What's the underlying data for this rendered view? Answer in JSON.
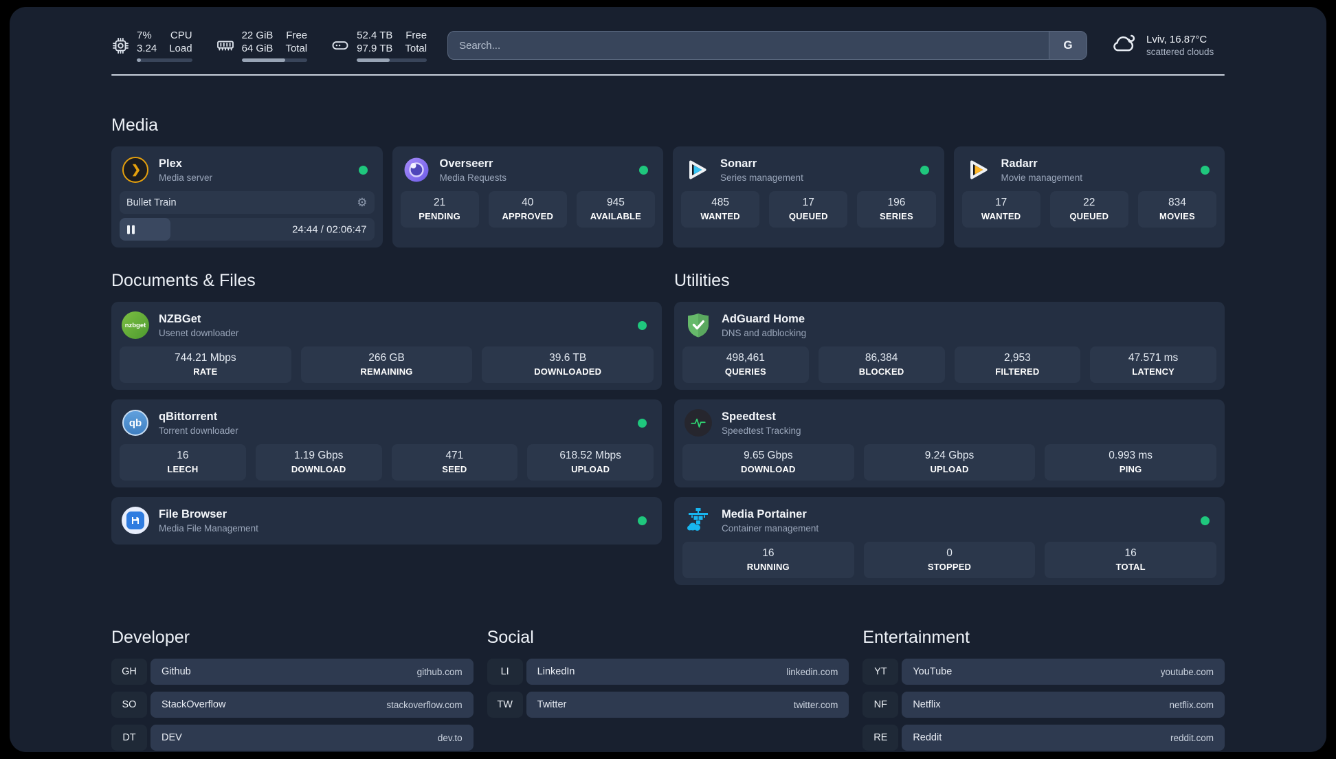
{
  "colors": {
    "status_online": "#1fc77d",
    "accent_plex": "#e5a00d",
    "sonarr_blue": "#36c3f2",
    "radarr_orange": "#ffb626",
    "adguard_green": "#66b96a",
    "portainer_blue": "#18b6f0",
    "speedtest_green": "#2fd573"
  },
  "header": {
    "stats": [
      {
        "icon": "cpu",
        "v1": "7%",
        "v2": "3.24",
        "l1": "CPU",
        "l2": "Load",
        "progress": 8
      },
      {
        "icon": "memory",
        "v1": "22 GiB",
        "v2": "64 GiB",
        "l1": "Free",
        "l2": "Total",
        "progress": 66
      },
      {
        "icon": "disk",
        "v1": "52.4 TB",
        "v2": "97.9 TB",
        "l1": "Free",
        "l2": "Total",
        "progress": 47
      }
    ],
    "search": {
      "placeholder": "Search...",
      "engine_label": "G"
    },
    "weather": {
      "location": "Lviv, 16.87°C",
      "condition": "scattered clouds"
    }
  },
  "sections": {
    "media": {
      "title": "Media",
      "plex": {
        "title": "Plex",
        "subtitle": "Media server",
        "status": "online",
        "now_playing": {
          "title": "Bullet Train",
          "time": "24:44 / 02:06:47",
          "progress": 20
        }
      },
      "overseerr": {
        "title": "Overseerr",
        "subtitle": "Media Requests",
        "status": "online",
        "stats": [
          {
            "value": "21",
            "label": "PENDING"
          },
          {
            "value": "40",
            "label": "APPROVED"
          },
          {
            "value": "945",
            "label": "AVAILABLE"
          }
        ]
      },
      "sonarr": {
        "title": "Sonarr",
        "subtitle": "Series management",
        "status": "online",
        "stats": [
          {
            "value": "485",
            "label": "WANTED"
          },
          {
            "value": "17",
            "label": "QUEUED"
          },
          {
            "value": "196",
            "label": "SERIES"
          }
        ]
      },
      "radarr": {
        "title": "Radarr",
        "subtitle": "Movie management",
        "status": "online",
        "stats": [
          {
            "value": "17",
            "label": "WANTED"
          },
          {
            "value": "22",
            "label": "QUEUED"
          },
          {
            "value": "834",
            "label": "MOVIES"
          }
        ]
      }
    },
    "documents": {
      "title": "Documents & Files",
      "nzbget": {
        "title": "NZBGet",
        "subtitle": "Usenet downloader",
        "status": "online",
        "stats": [
          {
            "value": "744.21 Mbps",
            "label": "RATE"
          },
          {
            "value": "266 GB",
            "label": "REMAINING"
          },
          {
            "value": "39.6 TB",
            "label": "DOWNLOADED"
          }
        ]
      },
      "qbittorrent": {
        "title": "qBittorrent",
        "subtitle": "Torrent downloader",
        "status": "online",
        "stats": [
          {
            "value": "16",
            "label": "LEECH"
          },
          {
            "value": "1.19 Gbps",
            "label": "DOWNLOAD"
          },
          {
            "value": "471",
            "label": "SEED"
          },
          {
            "value": "618.52 Mbps",
            "label": "UPLOAD"
          }
        ]
      },
      "filebrowser": {
        "title": "File Browser",
        "subtitle": "Media File Management",
        "status": "online"
      }
    },
    "utilities": {
      "title": "Utilities",
      "adguard": {
        "title": "AdGuard Home",
        "subtitle": "DNS and adblocking",
        "stats": [
          {
            "value": "498,461",
            "label": "QUERIES"
          },
          {
            "value": "86,384",
            "label": "BLOCKED"
          },
          {
            "value": "2,953",
            "label": "FILTERED"
          },
          {
            "value": "47.571 ms",
            "label": "LATENCY"
          }
        ]
      },
      "speedtest": {
        "title": "Speedtest",
        "subtitle": "Speedtest Tracking",
        "stats": [
          {
            "value": "9.65 Gbps",
            "label": "DOWNLOAD"
          },
          {
            "value": "9.24 Gbps",
            "label": "UPLOAD"
          },
          {
            "value": "0.993 ms",
            "label": "PING"
          }
        ]
      },
      "portainer": {
        "title": "Media Portainer",
        "subtitle": "Container management",
        "status": "online",
        "stats": [
          {
            "value": "16",
            "label": "RUNNING"
          },
          {
            "value": "0",
            "label": "STOPPED"
          },
          {
            "value": "16",
            "label": "TOTAL"
          }
        ]
      }
    },
    "bookmarks": [
      {
        "title": "Developer",
        "items": [
          {
            "abbr": "GH",
            "name": "Github",
            "url": "github.com"
          },
          {
            "abbr": "SO",
            "name": "StackOverflow",
            "url": "stackoverflow.com"
          },
          {
            "abbr": "DT",
            "name": "DEV",
            "url": "dev.to"
          }
        ]
      },
      {
        "title": "Social",
        "items": [
          {
            "abbr": "LI",
            "name": "LinkedIn",
            "url": "linkedin.com"
          },
          {
            "abbr": "TW",
            "name": "Twitter",
            "url": "twitter.com"
          }
        ]
      },
      {
        "title": "Entertainment",
        "items": [
          {
            "abbr": "YT",
            "name": "YouTube",
            "url": "youtube.com"
          },
          {
            "abbr": "NF",
            "name": "Netflix",
            "url": "netflix.com"
          },
          {
            "abbr": "RE",
            "name": "Reddit",
            "url": "reddit.com"
          }
        ]
      }
    ]
  },
  "icons": {
    "nzbget_text": "nzbget",
    "qbittorrent_text": "qb",
    "plex_chevron": "❯"
  }
}
